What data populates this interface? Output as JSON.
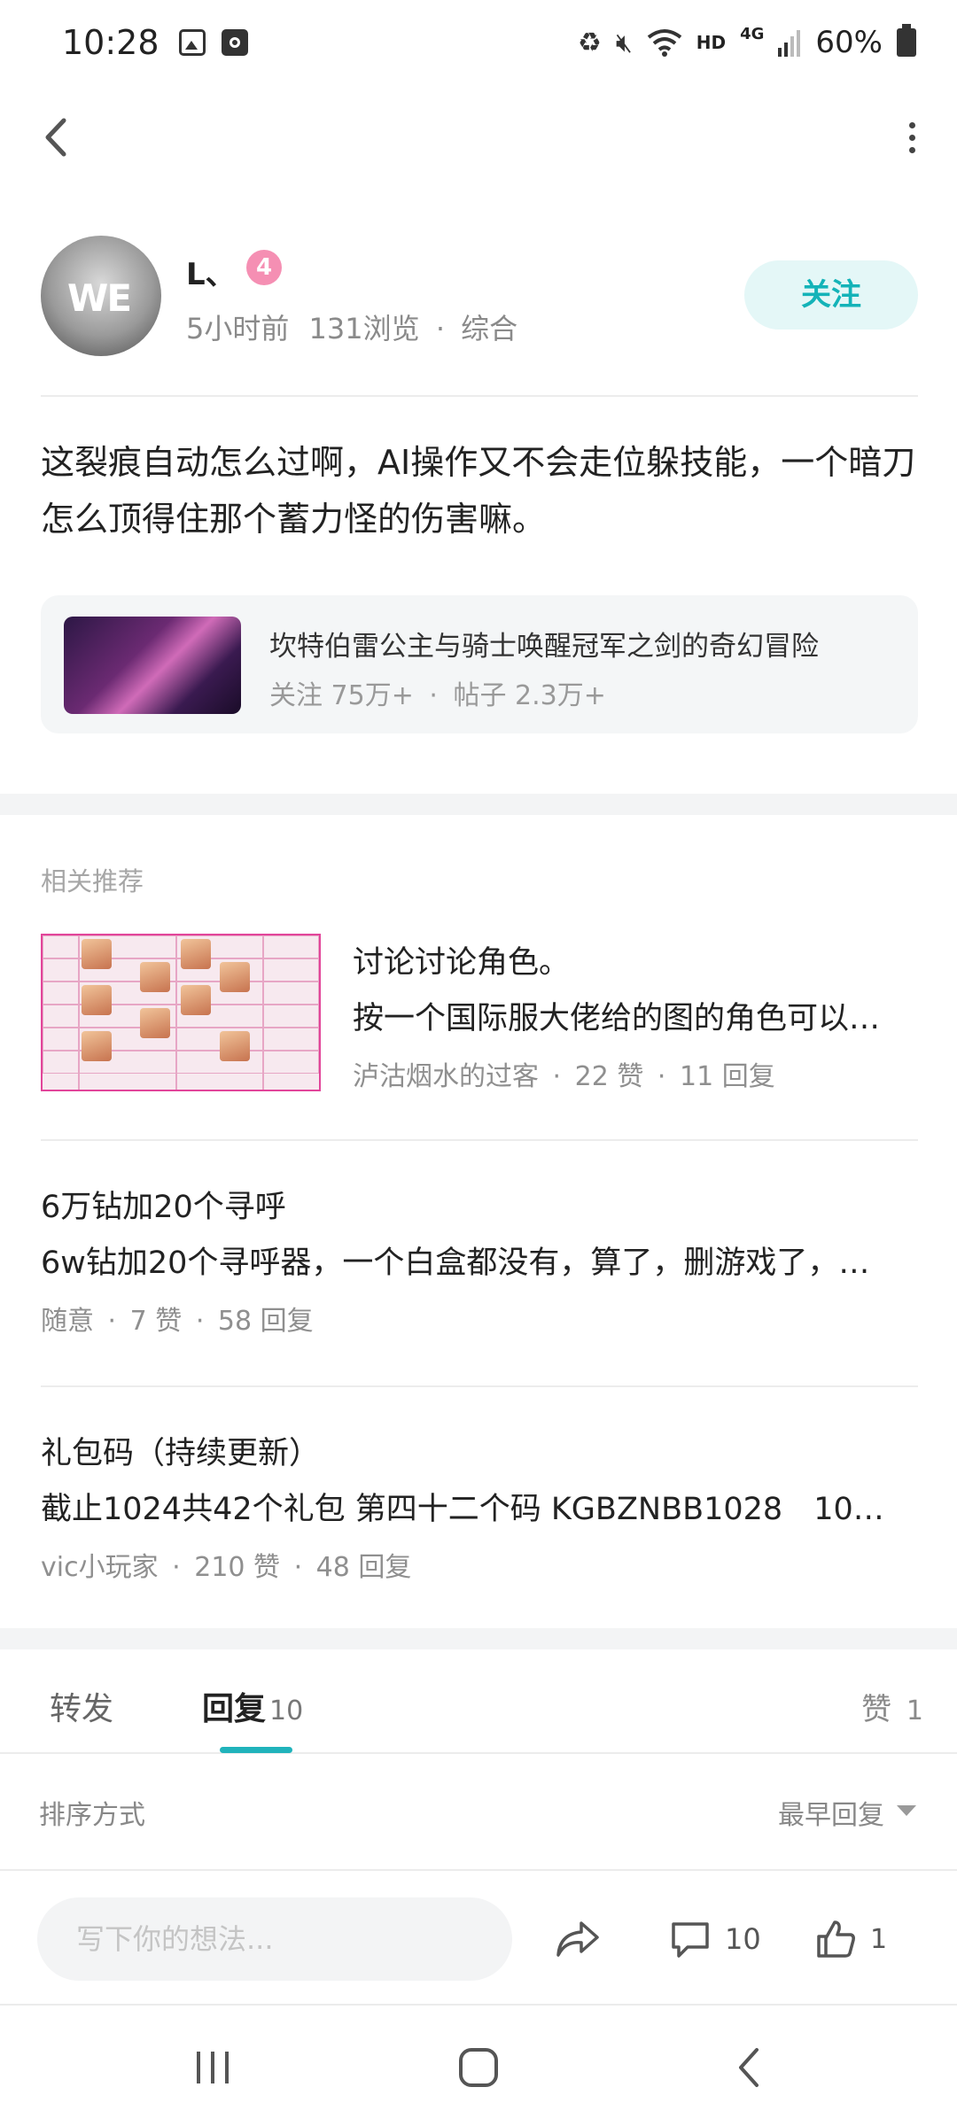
{
  "status_bar": {
    "time": "10:28",
    "network": "HD",
    "network_type": "4G",
    "battery": "60%"
  },
  "author": {
    "name": "L、",
    "level": "4",
    "time_ago": "5小时前",
    "views": "131浏览",
    "category": "综合",
    "follow_label": "关注",
    "avatar_text": "WE"
  },
  "post": {
    "body": "这裂痕自动怎么过啊，AI操作又不会走位躲技能，一个暗刀怎么顶得住那个蓄力怪的伤害嘛。"
  },
  "game": {
    "title": "坎特伯雷公主与骑士唤醒冠军之剑的奇幻冒险",
    "follows": "关注 75万+",
    "posts": "帖子 2.3万+"
  },
  "recommendations": {
    "section_title": "相关推荐",
    "items": [
      {
        "title": "讨论讨论角色。",
        "desc": "按一个国际服大佬给的图的角色可以…",
        "author": "泸沽烟水的过客",
        "likes": "22 赞",
        "replies": "11 回复"
      },
      {
        "title": "6万钻加20个寻呼",
        "desc": "6w钻加20个寻呼器，一个白盒都没有，算了，删游戏了，…",
        "author": "随意",
        "likes": "7 赞",
        "replies": "58 回复"
      },
      {
        "title": "礼包码（持续更新）",
        "desc": "截止1024共42个礼包 第四十二个码 KGBZNBB1028　10…",
        "author": "vic小玩家",
        "likes": "210 赞",
        "replies": "48 回复"
      }
    ]
  },
  "tabs": {
    "repost": "转发",
    "reply": "回复",
    "reply_count": "10",
    "like": "赞",
    "like_count": "1"
  },
  "sort": {
    "label": "排序方式",
    "value": "最早回复"
  },
  "action_bar": {
    "placeholder": "写下你的想法...",
    "comment_count": "10",
    "like_count": "1"
  },
  "colors": {
    "accent": "#20b3bb",
    "follow_bg": "#e4f7f7",
    "level_badge": "#f58fb3"
  }
}
